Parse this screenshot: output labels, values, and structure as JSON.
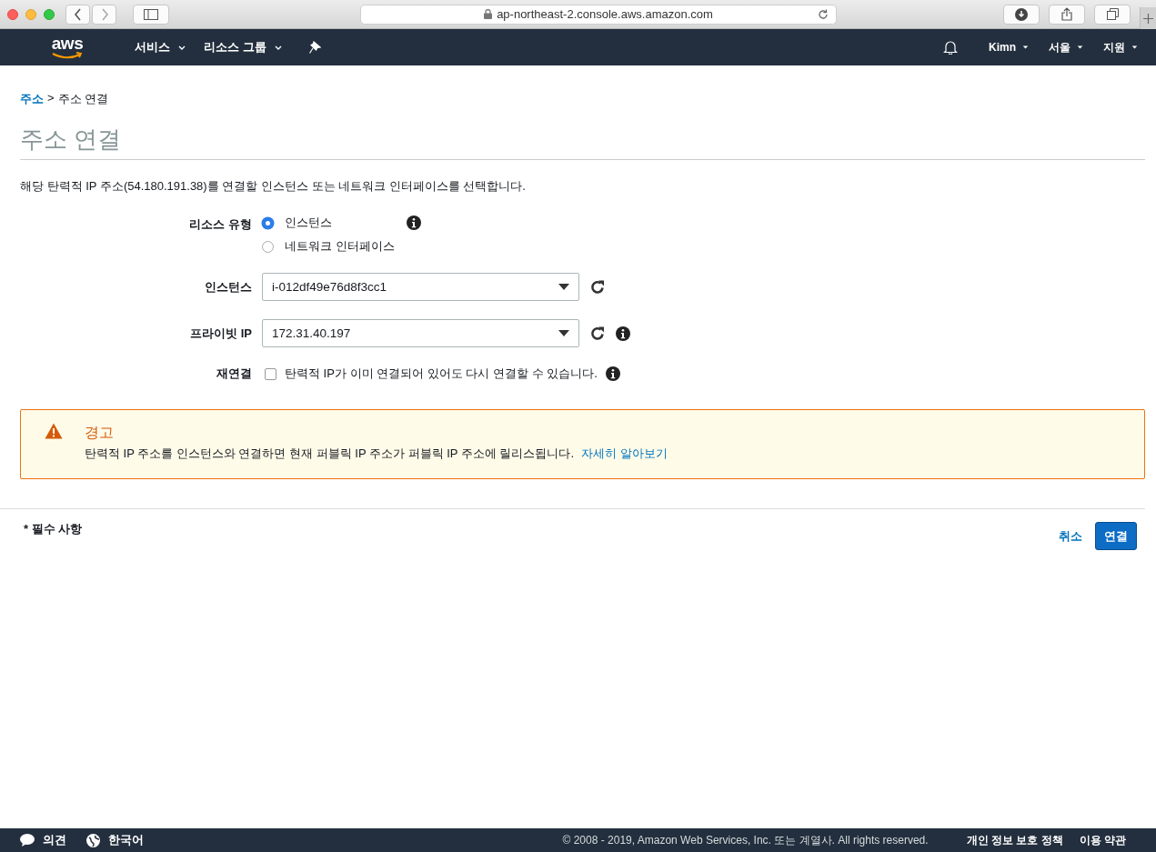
{
  "browser": {
    "url": "ap-northeast-2.console.aws.amazon.com"
  },
  "nav": {
    "logo": "aws",
    "menus": [
      {
        "label": "서비스"
      },
      {
        "label": "리소스 그룹"
      }
    ],
    "user_menus": [
      {
        "label": "Kimn"
      },
      {
        "label": "서울"
      },
      {
        "label": "지원"
      }
    ]
  },
  "breadcrumb": {
    "link": "주소",
    "separator": ">",
    "current": "주소 연결"
  },
  "title": "주소 연결",
  "description": "해당 탄력적 IP 주소(54.180.191.38)를 연결할 인스턴스 또는 네트워크 인터페이스를 선택합니다.",
  "form": {
    "resource_type": {
      "label": "리소스 유형",
      "options": [
        {
          "label": "인스턴스",
          "selected": true
        },
        {
          "label": "네트워크 인터페이스",
          "selected": false
        }
      ]
    },
    "instance": {
      "label": "인스턴스",
      "value": "i-012df49e76d8f3cc1"
    },
    "private_ip": {
      "label": "프라이빗 IP",
      "value": "172.31.40.197"
    },
    "reassociate": {
      "label": "재연결",
      "text": "탄력적 IP가 이미 연결되어 있어도 다시 연결할 수 있습니다.",
      "checked": false
    }
  },
  "warning": {
    "title": "경고",
    "text": "탄력적 IP 주소를 인스턴스와 연결하면 현재 퍼블릭 IP 주소가 퍼블릭 IP 주소에 릴리스됩니다.",
    "link": "자세히 알아보기"
  },
  "required_note": "* 필수 사항",
  "buttons": {
    "cancel": "취소",
    "submit": "연결"
  },
  "footer": {
    "feedback": "의견",
    "language": "한국어",
    "copyright": "© 2008 - 2019, Amazon Web Services, Inc. 또는 계열사. All rights reserved.",
    "links": [
      "개인 정보 보호 정책",
      "이용 약관"
    ]
  }
}
